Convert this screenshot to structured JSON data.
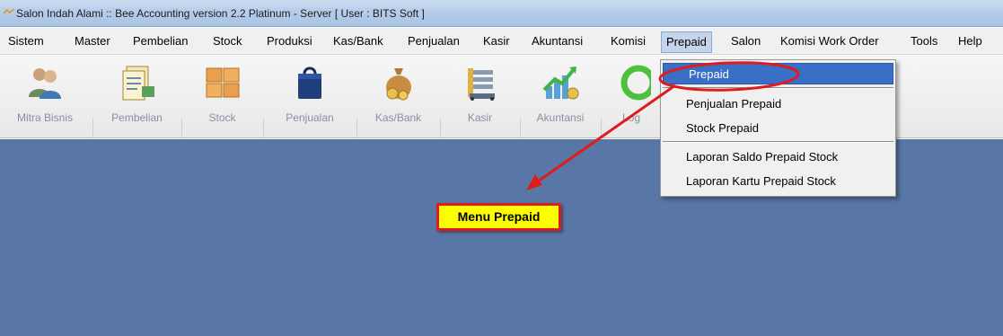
{
  "window": {
    "title": "Salon Indah Alami :: Bee Accounting version 2.2 Platinum - Server  [ User : BITS Soft ]"
  },
  "menubar": {
    "items": [
      "Sistem",
      "Master",
      "Pembelian",
      "Stock",
      "Produksi",
      "Kas/Bank",
      "Penjualan",
      "Kasir",
      "Akuntansi",
      "Komisi",
      "Prepaid",
      "Salon",
      "Komisi Work Order",
      "Tools",
      "Help"
    ],
    "active": "Prepaid"
  },
  "toolbar": {
    "items": [
      {
        "label": "Mitra Bisnis",
        "icon": "people-icon"
      },
      {
        "label": "Pembelian",
        "icon": "documents-icon"
      },
      {
        "label": "Stock",
        "icon": "boxes-icon"
      },
      {
        "label": "Penjualan",
        "icon": "shopping-bag-icon"
      },
      {
        "label": "Kas/Bank",
        "icon": "money-bag-icon"
      },
      {
        "label": "Kasir",
        "icon": "cashier-icon"
      },
      {
        "label": "Akuntansi",
        "icon": "chart-up-icon"
      },
      {
        "label": "Log",
        "icon": "logout-icon"
      }
    ]
  },
  "dropdown": {
    "items": [
      "Prepaid",
      "Penjualan Prepaid",
      "Stock Prepaid",
      "Laporan Saldo Prepaid Stock",
      "Laporan Kartu Prepaid Stock"
    ],
    "selected": "Prepaid"
  },
  "annotation": {
    "label": "Menu Prepaid"
  },
  "colors": {
    "workspace": "#5877a6",
    "highlight": "#3a6fc8",
    "annotation_border": "#e01b1b",
    "annotation_fill": "#ffff00"
  }
}
